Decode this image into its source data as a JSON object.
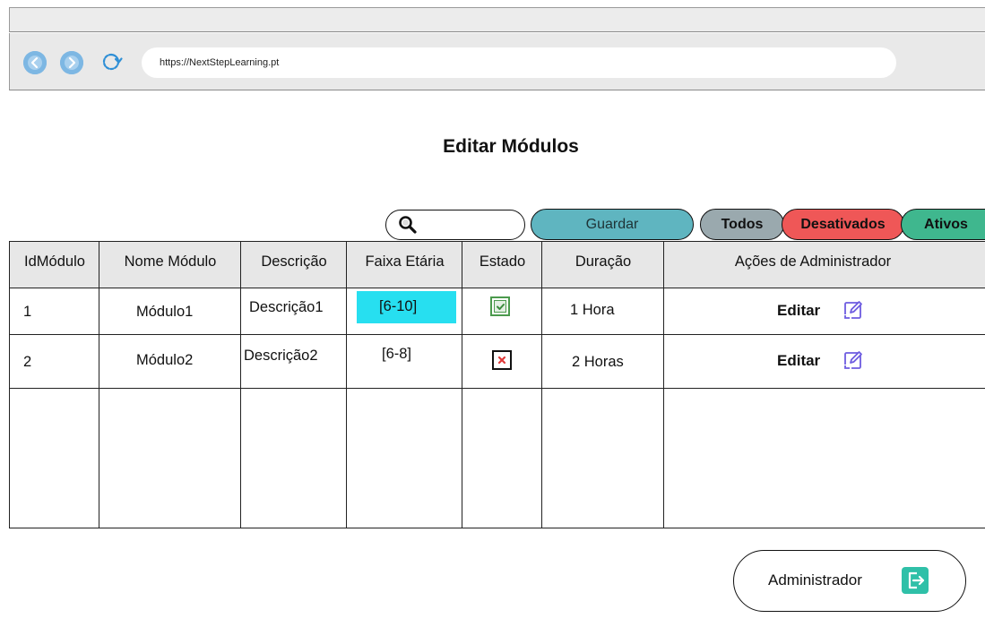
{
  "browser": {
    "url": "https://NextStepLearning.pt",
    "back_icon": "back-arrow-icon",
    "forward_icon": "forward-arrow-icon",
    "reload_icon": "reload-icon"
  },
  "page": {
    "title": "Editar Módulos"
  },
  "toolbar": {
    "search_placeholder": "",
    "search_value": "",
    "guardar_label": "Guardar",
    "filter_todos": "Todos",
    "filter_desativados": "Desativados",
    "filter_ativos": "Ativos",
    "colors": {
      "guardar": "#5fb5c0",
      "todos": "#9aa9ae",
      "desativados": "#ef5757",
      "ativos": "#3fb78e"
    }
  },
  "table": {
    "headers": {
      "id": "IdMódulo",
      "nome": "Nome Módulo",
      "descricao": "Descrição",
      "faixa": "Faixa Etária",
      "estado": "Estado",
      "duracao": "Duração",
      "acoes": "Ações de Administrador"
    },
    "rows": [
      {
        "id": "1",
        "nome": "Módulo1",
        "descricao": "Descrição1",
        "faixa": "[6-10]",
        "estado": "ativo",
        "duracao": "1 Hora",
        "acao": "Editar"
      },
      {
        "id": "2",
        "nome": "Módulo2",
        "descricao": "Descrição2",
        "faixa": "[6-8]",
        "estado": "desativado",
        "duracao": "2 Horas",
        "acao": "Editar"
      }
    ],
    "highlight_color": "#27dff0"
  },
  "footer": {
    "admin_label": "Administrador",
    "admin_icon": "logout-icon",
    "admin_icon_color": "#2fc0a8"
  }
}
